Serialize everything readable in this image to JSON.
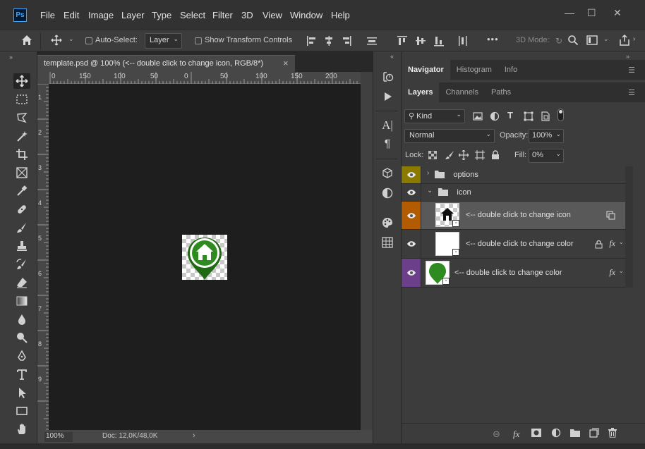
{
  "app": {
    "logo": "Ps"
  },
  "menu": [
    "File",
    "Edit",
    "Image",
    "Layer",
    "Type",
    "Select",
    "Filter",
    "3D",
    "View",
    "Window",
    "Help"
  ],
  "window_controls": {
    "minimize": "—",
    "restore": "☐",
    "close": "✕"
  },
  "options_bar": {
    "auto_select_label": "Auto-Select:",
    "auto_select_value": "Layer",
    "show_transform_label": "Show Transform Controls",
    "mode_3d_label": "3D Mode:",
    "more": "•••"
  },
  "document": {
    "tab_title": "template.psd @ 100% (<-- double click to change icon, RGB/8*)",
    "close": "×",
    "ruler_labels": [
      "0",
      "150",
      "100",
      "50",
      "0",
      "50",
      "100",
      "150",
      "200"
    ],
    "vruler_labels": [
      "1",
      "2",
      "3",
      "4",
      "5",
      "6",
      "7",
      "8",
      "9"
    ],
    "zoom": "100%",
    "doc_info": "Doc: 12,0K/48,0K"
  },
  "panels": {
    "top_tabs": [
      "Navigator",
      "Histogram",
      "Info"
    ],
    "layer_tabs": [
      "Layers",
      "Channels",
      "Paths"
    ],
    "filter_kind": "Kind",
    "blend_mode": "Normal",
    "opacity_label": "Opacity:",
    "opacity_value": "100%",
    "lock_label": "Lock:",
    "fill_label": "Fill:",
    "fill_value": "0%"
  },
  "layers": [
    {
      "name": "options",
      "type": "group",
      "collapsed": true,
      "eye_color": "#8a7a00"
    },
    {
      "name": "icon",
      "type": "group",
      "collapsed": false,
      "eye_color": "#3c3c3c"
    },
    {
      "name": "<-- double click to change icon",
      "type": "smart",
      "eye_color": "#b35b00",
      "selected": true
    },
    {
      "name": "<-- double click to change color",
      "type": "smart",
      "eye_color": "#3c3c3c",
      "locked": true,
      "fx": "fx"
    },
    {
      "name": "<-- double click to change color",
      "type": "smart",
      "eye_color": "#6b3f8a",
      "fx": "fx"
    }
  ],
  "colors": {
    "icon_green": "#2e8b1f",
    "icon_green_dark": "#1f6a12"
  }
}
